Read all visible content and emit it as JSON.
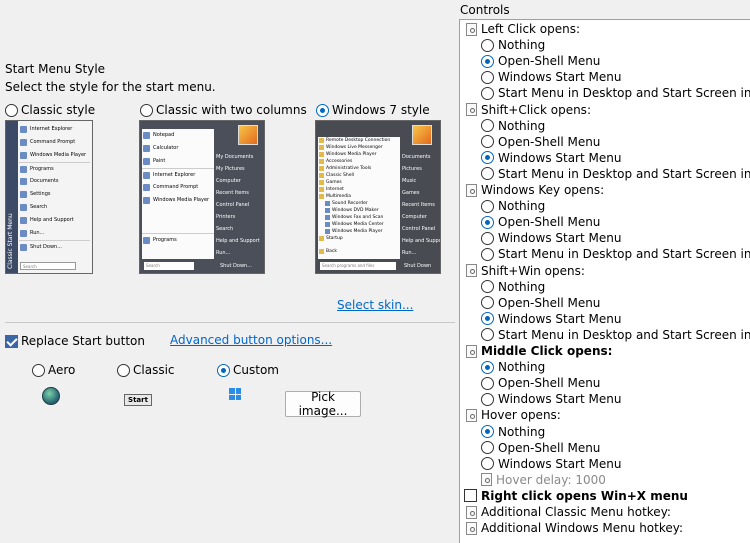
{
  "left": {
    "title": "Start Menu Style",
    "subtitle": "Select the style for the start menu.",
    "styles": [
      {
        "label": "Classic style",
        "selected": false
      },
      {
        "label": "Classic with two columns",
        "selected": false
      },
      {
        "label": "Windows 7 style",
        "selected": true
      }
    ],
    "thumb_classic": {
      "strip": "Classic Start Menu",
      "items": [
        "Internet Explorer",
        "Command Prompt",
        "Windows Media Player",
        "Programs",
        "Documents",
        "Settings",
        "Search",
        "Help and Support",
        "Run...",
        "Shut Down..."
      ],
      "search": "Search"
    },
    "thumb_two": {
      "left": [
        "Notepad",
        "Calculator",
        "Paint",
        "Internet Explorer",
        "Command Prompt",
        "Windows Media Player",
        "Programs"
      ],
      "right": [
        "My Documents",
        "My Pictures",
        "Computer",
        "Recent Items",
        "Control Panel",
        "Printers",
        "Search",
        "Help and Support",
        "Run..."
      ],
      "search": "Search",
      "shutdown": "Shut Down..."
    },
    "thumb_w7": {
      "left": [
        "Remote Desktop Connection",
        "Windows Live Messenger",
        "Windows Media Player",
        "Accessories",
        "Administrative Tools",
        "Classic Shell",
        "Games",
        "Internet",
        "Multimedia",
        "Sound Recorder",
        "Windows DVD Maker",
        "Windows Fax and Scan",
        "Windows Media Center",
        "Windows Media Player",
        "Startup",
        "Back"
      ],
      "right": [
        "Documents",
        "Pictures",
        "Music",
        "Games",
        "Recent Items",
        "Computer",
        "Control Panel",
        "Help and Support",
        "Run..."
      ],
      "search": "Search programs and files",
      "shutdown": "Shut Down"
    },
    "select_skin": "Select skin...",
    "replace_start": {
      "label": "Replace Start button",
      "checked": true
    },
    "advanced_button": "Advanced button options...",
    "button_styles": [
      {
        "label": "Aero",
        "selected": false
      },
      {
        "label": "Classic",
        "selected": false
      },
      {
        "label": "Custom",
        "selected": true
      }
    ],
    "classic_start_text": "Start",
    "pick_image": "Pick image..."
  },
  "controls": {
    "label": "Controls",
    "groups": [
      {
        "title": "Left Click opens:",
        "bold": false,
        "options": [
          "Nothing",
          "Open-Shell Menu",
          "Windows Start Menu",
          "Start Menu in Desktop and Start Screen in Metro"
        ],
        "selected": 1
      },
      {
        "title": "Shift+Click opens:",
        "bold": false,
        "options": [
          "Nothing",
          "Open-Shell Menu",
          "Windows Start Menu",
          "Start Menu in Desktop and Start Screen in Metro"
        ],
        "selected": 2
      },
      {
        "title": "Windows Key opens:",
        "bold": false,
        "options": [
          "Nothing",
          "Open-Shell Menu",
          "Windows Start Menu",
          "Start Menu in Desktop and Start Screen in Metro"
        ],
        "selected": 1
      },
      {
        "title": "Shift+Win opens:",
        "bold": false,
        "options": [
          "Nothing",
          "Open-Shell Menu",
          "Windows Start Menu",
          "Start Menu in Desktop and Start Screen in Metro"
        ],
        "selected": 2
      },
      {
        "title": "Middle Click opens:",
        "bold": true,
        "options": [
          "Nothing",
          "Open-Shell Menu",
          "Windows Start Menu"
        ],
        "selected": 0
      },
      {
        "title": "Hover opens:",
        "bold": false,
        "options": [
          "Nothing",
          "Open-Shell Menu",
          "Windows Start Menu"
        ],
        "selected": 0
      }
    ],
    "hover_delay": "Hover delay: 1000",
    "right_click": "Right click opens Win+X menu",
    "classic_hotkey": "Additional Classic Menu hotkey:",
    "windows_hotkey": "Additional Windows Menu hotkey:"
  }
}
